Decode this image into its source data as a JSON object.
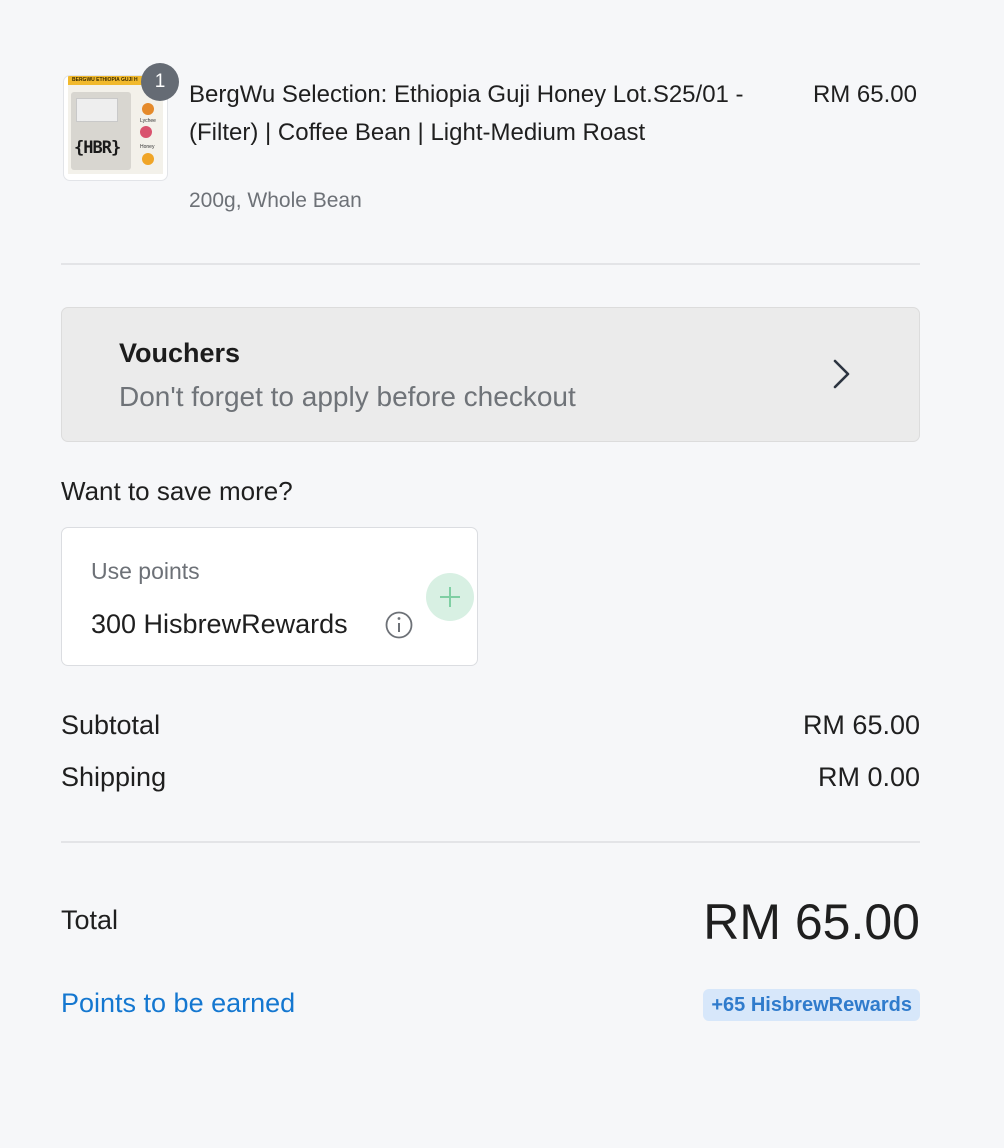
{
  "product": {
    "quantity": "1",
    "title": "BergWu Selection: Ethiopia Guji Honey Lot.S25/01 - (Filter) | Coffee Bean | Light-Medium Roast",
    "variant": "200g, Whole Bean",
    "price": "RM 65.00",
    "image": {
      "top_band_text": "BERGWU ETHIOPIA GUJI H",
      "logo_text": "{HBR}",
      "flavor_labels": [
        "Lychee",
        "Honey"
      ]
    }
  },
  "voucher": {
    "title": "Vouchers",
    "subtitle": "Don't forget to apply before checkout",
    "icon": "chevron-right-icon"
  },
  "save_more": {
    "heading": "Want to save more?"
  },
  "points": {
    "label": "Use points",
    "value": "300 HisbrewRewards",
    "info_icon": "info-icon",
    "add_icon": "plus-icon"
  },
  "summary": {
    "subtotal_label": "Subtotal",
    "subtotal_value": "RM 65.00",
    "shipping_label": "Shipping",
    "shipping_value": "RM 0.00",
    "total_label": "Total",
    "total_value": "RM 65.00",
    "earn_label": "Points to be earned",
    "earn_value": "+65 HisbrewRewards"
  },
  "colors": {
    "background": "#f6f7f9",
    "link": "#1477d0",
    "badge_bg": "#d7e7fa",
    "add_button_bg": "#d8f0e3",
    "add_button_icon": "#7fcfa3",
    "quantity_badge": "#656b74"
  }
}
